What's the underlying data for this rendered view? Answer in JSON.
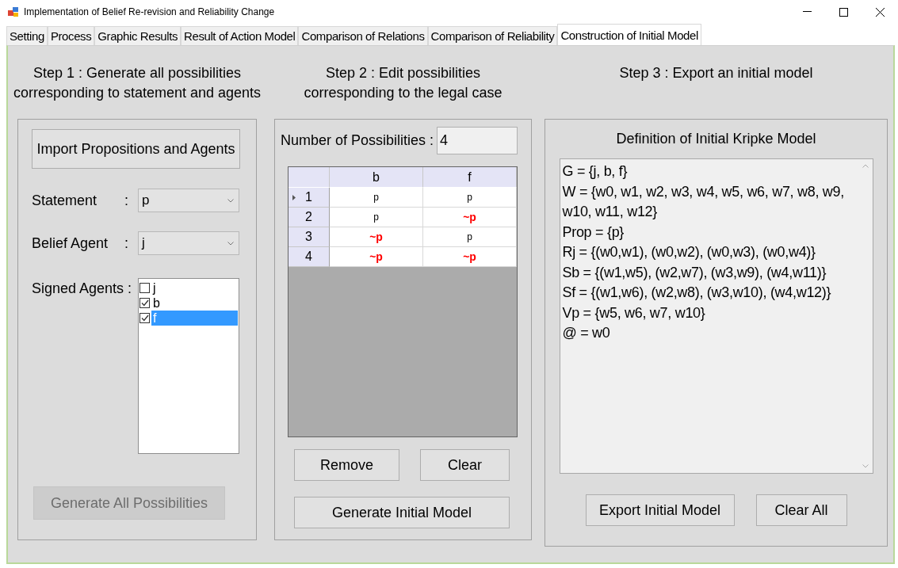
{
  "window": {
    "title": "Implementation of Belief Re-revision and Reliability Change"
  },
  "tabs": [
    {
      "label": "Setting",
      "selected": false
    },
    {
      "label": "Process",
      "selected": false
    },
    {
      "label": "Graphic Results",
      "selected": false
    },
    {
      "label": "Result of Action Model",
      "selected": false
    },
    {
      "label": "Comparison of Relations",
      "selected": false
    },
    {
      "label": "Comparison of Reliability",
      "selected": false
    },
    {
      "label": "Construction of Initial Model",
      "selected": true
    }
  ],
  "step1": {
    "heading": [
      "Step 1 : Generate all possibilities",
      "corresponding to statement and agents"
    ],
    "import_button": "Import Propositions and Agents",
    "statement": {
      "label": "Statement",
      "colon": ":",
      "value": "p"
    },
    "belief_agent": {
      "label": "Belief Agent",
      "colon": ":",
      "value": "j"
    },
    "signed_agents": {
      "label": "Signed Agents :",
      "items": [
        {
          "label": "j",
          "checked": false,
          "selected": false
        },
        {
          "label": "b",
          "checked": true,
          "selected": false
        },
        {
          "label": "f",
          "checked": true,
          "selected": true
        }
      ]
    },
    "generate_button": {
      "label": "Generate All Possibilities",
      "disabled": true
    }
  },
  "step2": {
    "heading": [
      "Step 2 : Edit possibilities",
      "corresponding to the legal case"
    ],
    "count_label": "Number of Possibilities :",
    "count_value": "4",
    "table": {
      "columns": [
        "b",
        "f"
      ],
      "rows": [
        {
          "header": "1",
          "current": true,
          "cells": [
            {
              "text": "p",
              "negated": false
            },
            {
              "text": "p",
              "negated": false
            }
          ]
        },
        {
          "header": "2",
          "current": false,
          "cells": [
            {
              "text": "p",
              "negated": false
            },
            {
              "text": "~p",
              "negated": true
            }
          ]
        },
        {
          "header": "3",
          "current": false,
          "cells": [
            {
              "text": "~p",
              "negated": true
            },
            {
              "text": "p",
              "negated": false
            }
          ]
        },
        {
          "header": "4",
          "current": false,
          "cells": [
            {
              "text": "~p",
              "negated": true
            },
            {
              "text": "~p",
              "negated": true
            }
          ]
        }
      ]
    },
    "buttons": [
      "Remove",
      "Clear"
    ],
    "generate_button": "Generate Initial Model"
  },
  "step3": {
    "heading": [
      "Step 3 : Export an initial model"
    ],
    "title": "Definition of Initial Kripke Model",
    "lines": [
      "G = {j, b, f}",
      "W = {w0, w1, w2, w3, w4, w5, w6, w7, w8, w9,",
      "w10, w11, w12}",
      "Prop = {p}",
      "Rj = {(w0,w1), (w0,w2), (w0,w3), (w0,w4)}",
      "Sb = {(w1,w5), (w2,w7), (w3,w9), (w4,w11)}",
      "Sf = {(w1,w6), (w2,w8), (w3,w10), (w4,w12)}",
      "Vp = {w5, w6, w7, w10}",
      "@ = w0"
    ],
    "buttons": [
      "Export Initial Model",
      "Clear All"
    ]
  }
}
